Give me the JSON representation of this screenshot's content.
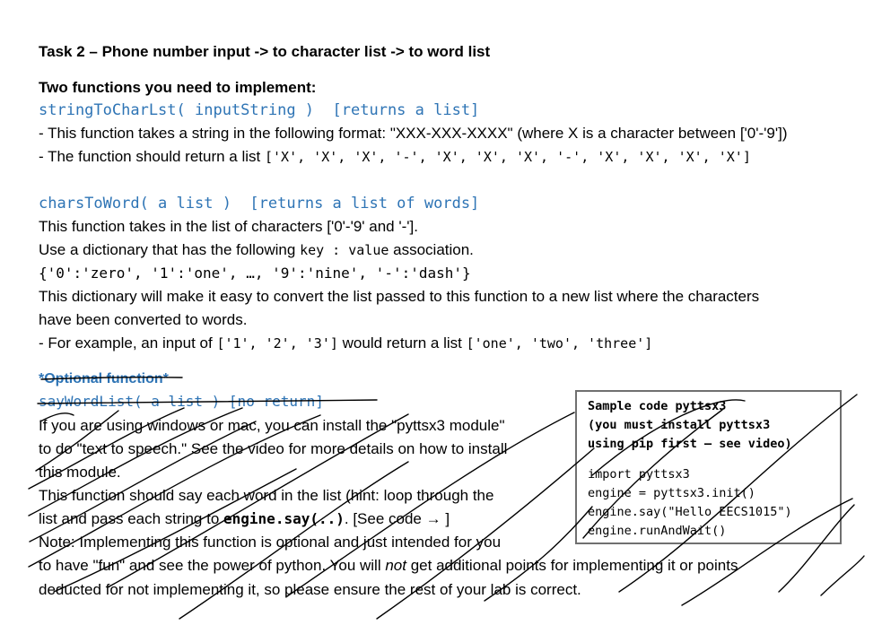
{
  "task_title": "Task 2 – Phone number input -> to character list -> to word list",
  "intro_heading": "Two functions you need to implement:",
  "func1": {
    "signature": "stringToCharLst( inputString )",
    "returns": "[returns a list]",
    "desc1_prefix": "- This function takes a string in the following format: \"XXX-XXX-XXXX\" (where X is a character between ['0'-'9'])",
    "desc2_prefix": "- The function should return a list ",
    "desc2_list": "['X', 'X', 'X', '-', 'X', 'X', 'X', '-', 'X', 'X', 'X', 'X']"
  },
  "func2": {
    "signature": "charsToWord( a list )",
    "returns": "[returns a list of words]",
    "line1": "This function takes in the list of characters ['0'-'9' and '-'].",
    "line2_a": "Use a dictionary that has the following ",
    "line2_code": "key : value",
    "line2_b": " association.",
    "dict_code": "{'0':'zero', '1':'one', …, '9':'nine', '-':'dash'}",
    "line3": "This dictionary will make it easy to convert the list passed to this function to a new list where the characters",
    "line4": "have been converted to words.",
    "example_a": "- For example, an input of ",
    "example_input": "['1', '2', '3']",
    "example_b": " would return a list ",
    "example_output": "['one', 'two', 'three']"
  },
  "optional": {
    "heading": "*Optional function*",
    "signature": "sayWordList( a list ) [no return]",
    "p1": "If you are using windows or mac, you can install the \"pyttsx3 module\"",
    "p2": "to do \"text to speech.\"  See the video for more details on how to install",
    "p3": "this module.",
    "p4": "This function should say each word in the list (hint: loop through the",
    "p5_a": "list and pass each string to ",
    "p5_code": "engine.say(..)",
    "p5_b": ". [See code → ]",
    "p6": "Note: Implementing this function is optional and just intended for you",
    "p7_a": "to  have \"fun\" and see the power of python.   You will ",
    "p7_em": "not",
    "p7_b": " get additional points for implementing it or points",
    "p8": "deducted for not implementing it, so please ensure the rest of your lab is correct."
  },
  "sample_code": {
    "header": [
      "Sample code pyttsx3",
      "(you must install pyttsx3",
      "using pip first – see video)"
    ],
    "lines": [
      "import pyttsx3",
      "engine = pyttsx3.init()",
      "engine.say(\"Hello EECS1015\")",
      "engine.runAndWait()"
    ]
  },
  "colors": {
    "code_blue": "#2e74b5",
    "text": "#000000",
    "box_border": "#707070"
  }
}
